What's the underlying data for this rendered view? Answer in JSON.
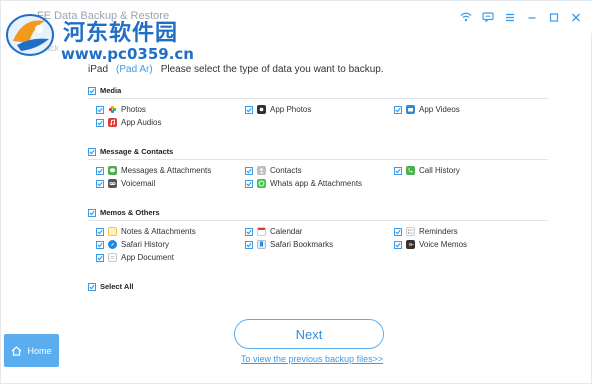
{
  "title_bar": {
    "app_title": "FE Data Backup & Restore",
    "icons": [
      "wifi-icon",
      "chat-icon",
      "menu-icon",
      "minimize-icon",
      "maximize-icon",
      "close-icon"
    ]
  },
  "watermark": {
    "title": "河东软件园",
    "url": "www.pc0359.cn"
  },
  "back_label": "Back",
  "device": {
    "name": "iPad",
    "model": "(Pad Ar)",
    "prompt": "Please select the type of data you want to backup."
  },
  "sections": {
    "media": {
      "label": "Media",
      "items": [
        "Photos",
        "App Photos",
        "App Videos",
        "App Audios"
      ]
    },
    "messages": {
      "label": "Message & Contacts",
      "items": [
        "Messages & Attachments",
        "Contacts",
        "Call History",
        "Voicemail",
        "Whats app & Attachments"
      ]
    },
    "memos": {
      "label": "Memos & Others",
      "items": [
        "Notes & Attachments",
        "Calendar",
        "Reminders",
        "Safari History",
        "Safari Bookmarks",
        "Voice Memos",
        "App Document"
      ]
    }
  },
  "select_all_label": "Select All",
  "next_label": "Next",
  "prev_backup_link": "To view the previous backup files>>",
  "home_label": "Home",
  "colors": {
    "accent": "#3b9be8",
    "home_bg": "#5aaef0",
    "watermark": "#1f6fc7"
  }
}
